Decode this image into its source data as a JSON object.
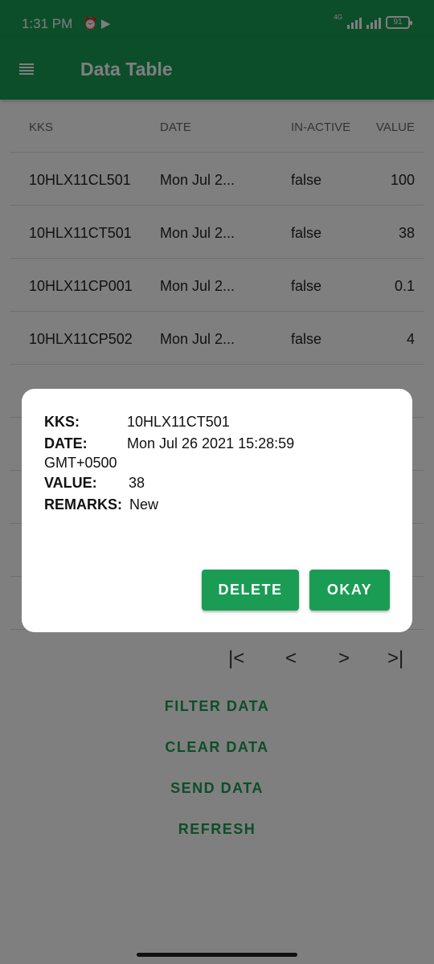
{
  "status_bar": {
    "time": "1:31 PM",
    "network": "4G",
    "battery": "91"
  },
  "app_bar": {
    "title": "Data Table"
  },
  "table": {
    "headers": [
      "KKS",
      "DATE",
      "IN-ACTIVE",
      "VALUE"
    ],
    "rows": [
      {
        "kks": "10HLX11CL501",
        "date": "Mon Jul 2...",
        "inactive": "false",
        "value": "100"
      },
      {
        "kks": "10HLX11CT501",
        "date": "Mon Jul 2...",
        "inactive": "false",
        "value": "38"
      },
      {
        "kks": "10HLX11CP001",
        "date": "Mon Jul 2...",
        "inactive": "false",
        "value": "0.1"
      },
      {
        "kks": "10HLX11CP502",
        "date": "Mon Jul 2...",
        "inactive": "false",
        "value": "4"
      }
    ]
  },
  "pager": {
    "first": "|<",
    "prev": "<",
    "next": ">",
    "last": ">|"
  },
  "actions": {
    "filter": "FILTER DATA",
    "clear": "CLEAR DATA",
    "send": "SEND DATA",
    "refresh": "REFRESH"
  },
  "dialog": {
    "kks_label": "KKS:",
    "kks_value": "10HLX11CT501",
    "date_label": "DATE:",
    "date_value": "Mon Jul 26 2021 15:28:59",
    "date_value_cont": "GMT+0500",
    "value_label": "VALUE:",
    "value_value": "38",
    "remarks_label": "REMARKS:",
    "remarks_value": "New",
    "delete_button": "DELETE",
    "okay_button": "OKAY"
  }
}
